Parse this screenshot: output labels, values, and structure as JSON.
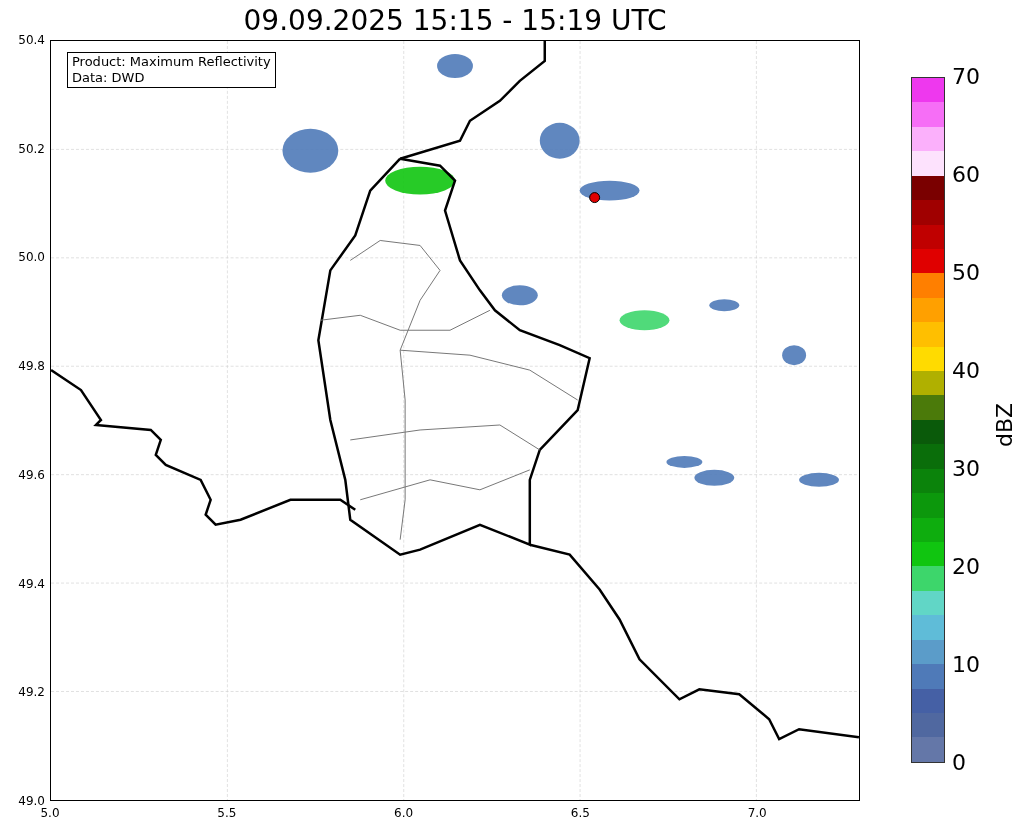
{
  "title": "09.09.2025 15:15 - 15:19 UTC",
  "info_box": [
    "Product: Maximum Reflectivity",
    "Data: DWD"
  ],
  "x_ticks": [
    "5.0",
    "5.5",
    "6.0",
    "6.5",
    "7.0"
  ],
  "y_ticks": [
    "50.4",
    "50.2",
    "50.0",
    "49.8",
    "49.6",
    "49.4",
    "49.2",
    "49.0"
  ],
  "colorbar": {
    "label": "dBZ",
    "ticks": [
      "70",
      "60",
      "50",
      "40",
      "30",
      "20",
      "10",
      "0"
    ],
    "segments": [
      {
        "color": "#ee38ee"
      },
      {
        "color": "#f66ef6"
      },
      {
        "color": "#fbb0fb"
      },
      {
        "color": "#fde2fd"
      },
      {
        "color": "#7a0000"
      },
      {
        "color": "#a00000"
      },
      {
        "color": "#c00000"
      },
      {
        "color": "#e00000"
      },
      {
        "color": "#ff7f00"
      },
      {
        "color": "#ffa000"
      },
      {
        "color": "#ffbf00"
      },
      {
        "color": "#ffdb00"
      },
      {
        "color": "#b0b000"
      },
      {
        "color": "#4b7a0a"
      },
      {
        "color": "#0a5a0a"
      },
      {
        "color": "#0a6e0a"
      },
      {
        "color": "#0b830b"
      },
      {
        "color": "#0c980c"
      },
      {
        "color": "#0ead0e"
      },
      {
        "color": "#10c510"
      },
      {
        "color": "#3dd66b"
      },
      {
        "color": "#61d6c6"
      },
      {
        "color": "#5fbcd8"
      },
      {
        "color": "#5b9cc9"
      },
      {
        "color": "#4f7ab8"
      },
      {
        "color": "#4560a5"
      },
      {
        "color": "#5068a0"
      },
      {
        "color": "#6477a8"
      }
    ]
  }
}
